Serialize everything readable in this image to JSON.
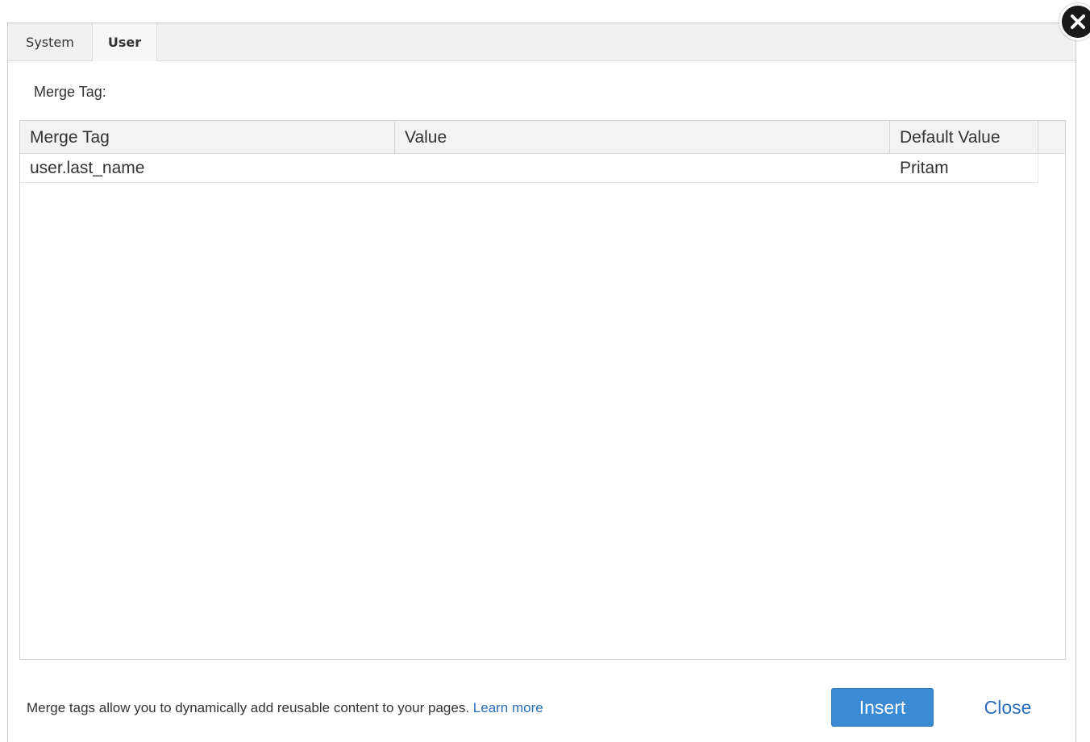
{
  "tabs": [
    {
      "label": "System",
      "active": false
    },
    {
      "label": "User",
      "active": true
    }
  ],
  "merge_tag_label": "Merge Tag:",
  "table": {
    "columns": [
      "Merge Tag",
      "Value",
      "Default Value"
    ],
    "rows": [
      {
        "merge_tag": "user.last_name",
        "value": "",
        "default_value": "Pritam"
      }
    ]
  },
  "footer": {
    "note": "Merge tags allow you to dynamically add reusable content to your pages.",
    "learn_more": "Learn more"
  },
  "buttons": {
    "insert": "Insert",
    "close": "Close"
  },
  "icons": {
    "close_dialog": "close-icon"
  },
  "colors": {
    "primary_button": "#3b8ad4",
    "link": "#2a6ebb"
  }
}
